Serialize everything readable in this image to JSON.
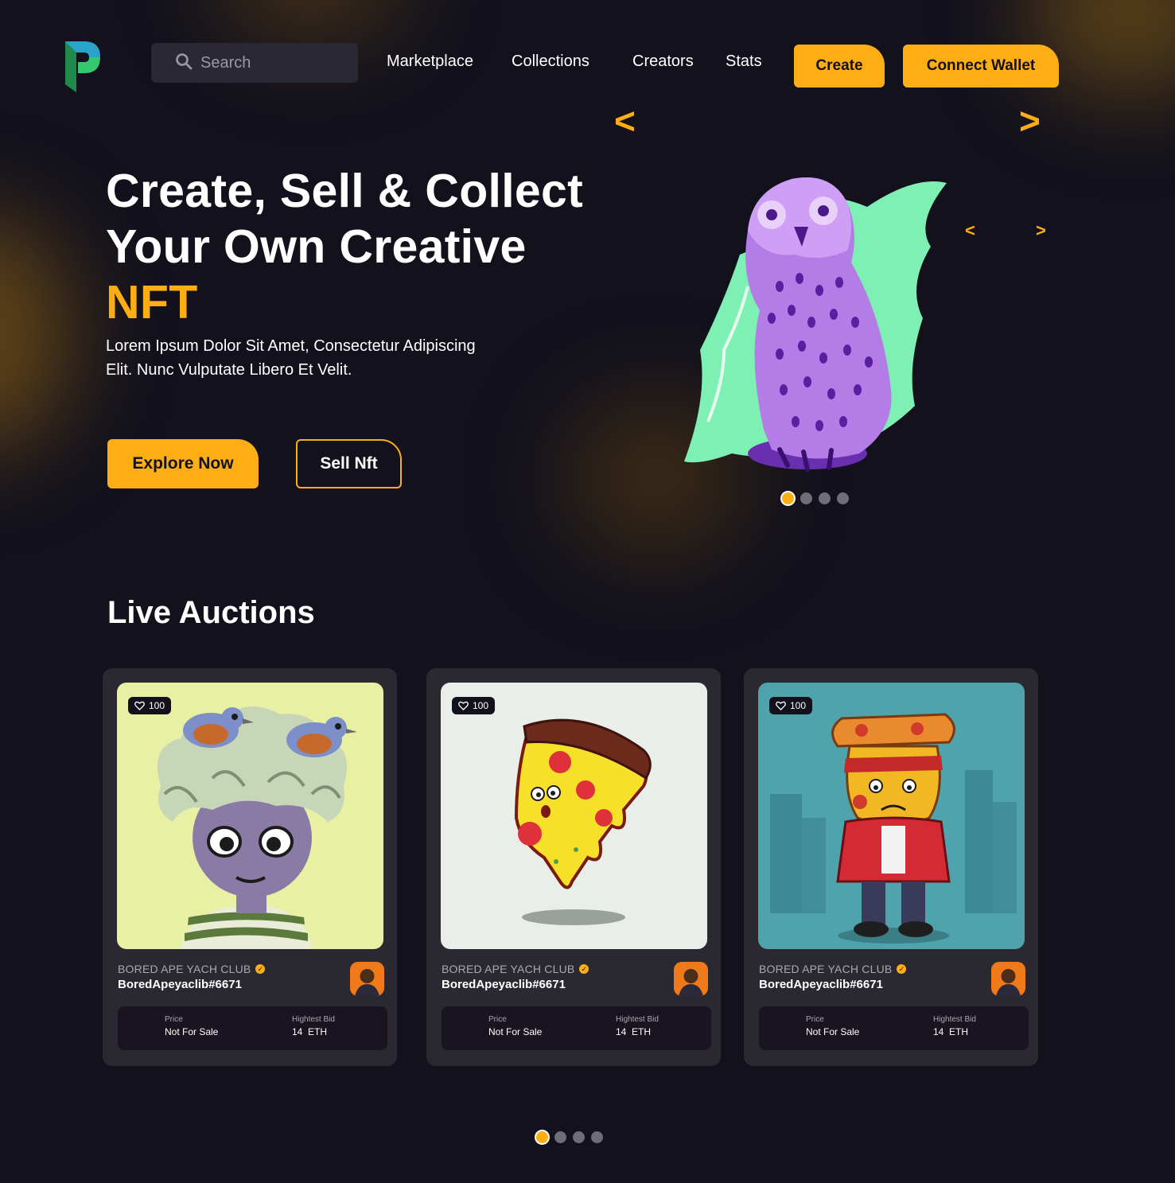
{
  "header": {
    "search_placeholder": "Search",
    "nav": [
      "Marketplace",
      "Collections",
      "Creators",
      "Stats"
    ],
    "create_label": "Create",
    "wallet_label": "Connect Wallet"
  },
  "hero": {
    "title_line1": "Create, Sell & Collect",
    "title_line2": "Your Own Creative",
    "title_accent": "NFT",
    "description": "Lorem Ipsum Dolor Sit Amet, Consectetur Adipiscing Elit. Nunc Vulputate Libero Et Velit.",
    "explore_label": "Explore Now",
    "sell_label": "Sell Nft",
    "arrow_prev": "<",
    "arrow_next": ">",
    "carousel_page": 1,
    "carousel_pages": 4
  },
  "auctions": {
    "title": "Live Auctions",
    "carousel_page": 1,
    "carousel_pages": 4,
    "cards": [
      {
        "likes": "100",
        "collection": "BORED APE YACH CLUB",
        "name": "BoredApeyaclib#6671",
        "price_label": "Price",
        "price_value": "Not For Sale",
        "bid_label": "Hightest Bid",
        "bid_value": "14  ETH",
        "art": "bird-hair-character"
      },
      {
        "likes": "100",
        "collection": "BORED APE YACH CLUB",
        "name": "BoredApeyaclib#6671",
        "price_label": "Price",
        "price_value": "Not For Sale",
        "bid_label": "Hightest Bid",
        "bid_value": "14  ETH",
        "art": "pizza-slice"
      },
      {
        "likes": "100",
        "collection": "BORED APE YACH CLUB",
        "name": "BoredApeyaclib#6671",
        "price_label": "Price",
        "price_value": "Not For Sale",
        "bid_label": "Hightest Bid",
        "bid_value": "14  ETH",
        "art": "pizza-man"
      }
    ]
  },
  "colors": {
    "accent": "#fcae14",
    "background": "#12111c",
    "card": "#2a2931",
    "info_box": "#19141f"
  },
  "icons": [
    "logo-icon",
    "search-icon",
    "heart-icon",
    "verified-icon",
    "avatar-icon"
  ]
}
